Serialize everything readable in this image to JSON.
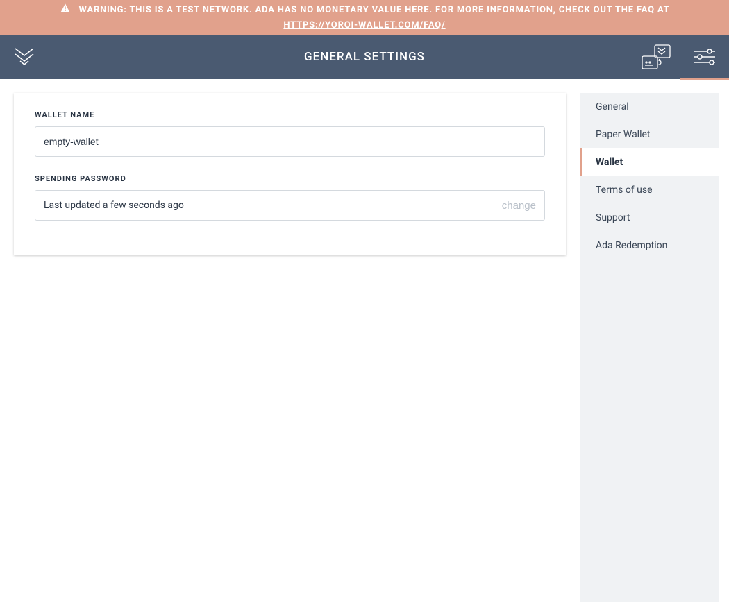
{
  "banner": {
    "text": "WARNING: THIS IS A TEST NETWORK. ADA HAS NO MONETARY VALUE HERE. FOR MORE INFORMATION, CHECK OUT THE FAQ AT",
    "link_text": "HTTPS://YOROI-WALLET.COM/FAQ/"
  },
  "header": {
    "title": "GENERAL SETTINGS"
  },
  "form": {
    "wallet_name_label": "WALLET NAME",
    "wallet_name_value": "empty-wallet",
    "spending_password_label": "SPENDING PASSWORD",
    "spending_password_status": "Last updated a few seconds ago",
    "change_label": "change"
  },
  "sidebar": {
    "items": [
      {
        "key": "general",
        "label": "General",
        "active": false
      },
      {
        "key": "paper-wallet",
        "label": "Paper Wallet",
        "active": false
      },
      {
        "key": "wallet",
        "label": "Wallet",
        "active": true
      },
      {
        "key": "terms-of-use",
        "label": "Terms of use",
        "active": false
      },
      {
        "key": "support",
        "label": "Support",
        "active": false
      },
      {
        "key": "ada-redemption",
        "label": "Ada Redemption",
        "active": false
      }
    ]
  },
  "colors": {
    "accent": "#E1A18C",
    "header_bg": "#4A5A71",
    "sidebar_bg": "#F0F2F4"
  }
}
